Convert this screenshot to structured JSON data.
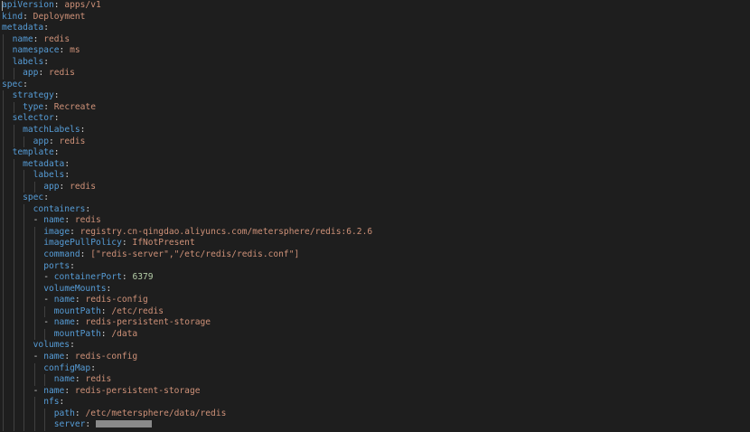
{
  "colors": {
    "background": "#1e1e1e",
    "key": "#569cd6",
    "string": "#ce9178",
    "number": "#b5cea8",
    "punctuation": "#d4d4d4",
    "indent_guide": "#404040"
  },
  "lines": [
    {
      "indent": 0,
      "dash": false,
      "key": "apiVersion",
      "value": "apps/v1",
      "vtype": "str"
    },
    {
      "indent": 0,
      "dash": false,
      "key": "kind",
      "value": "Deployment",
      "vtype": "str"
    },
    {
      "indent": 0,
      "dash": false,
      "key": "metadata",
      "value": "",
      "vtype": "none"
    },
    {
      "indent": 1,
      "dash": false,
      "key": "name",
      "value": "redis",
      "vtype": "str"
    },
    {
      "indent": 1,
      "dash": false,
      "key": "namespace",
      "value": "ms",
      "vtype": "str"
    },
    {
      "indent": 1,
      "dash": false,
      "key": "labels",
      "value": "",
      "vtype": "none"
    },
    {
      "indent": 2,
      "dash": false,
      "key": "app",
      "value": "redis",
      "vtype": "str"
    },
    {
      "indent": 0,
      "dash": false,
      "key": "spec",
      "value": "",
      "vtype": "none"
    },
    {
      "indent": 1,
      "dash": false,
      "key": "strategy",
      "value": "",
      "vtype": "none"
    },
    {
      "indent": 2,
      "dash": false,
      "key": "type",
      "value": "Recreate",
      "vtype": "str"
    },
    {
      "indent": 1,
      "dash": false,
      "key": "selector",
      "value": "",
      "vtype": "none"
    },
    {
      "indent": 2,
      "dash": false,
      "key": "matchLabels",
      "value": "",
      "vtype": "none"
    },
    {
      "indent": 3,
      "dash": false,
      "key": "app",
      "value": "redis",
      "vtype": "str"
    },
    {
      "indent": 1,
      "dash": false,
      "key": "template",
      "value": "",
      "vtype": "none"
    },
    {
      "indent": 2,
      "dash": false,
      "key": "metadata",
      "value": "",
      "vtype": "none"
    },
    {
      "indent": 3,
      "dash": false,
      "key": "labels",
      "value": "",
      "vtype": "none"
    },
    {
      "indent": 4,
      "dash": false,
      "key": "app",
      "value": "redis",
      "vtype": "str"
    },
    {
      "indent": 2,
      "dash": false,
      "key": "spec",
      "value": "",
      "vtype": "none"
    },
    {
      "indent": 3,
      "dash": false,
      "key": "containers",
      "value": "",
      "vtype": "none"
    },
    {
      "indent": 3,
      "dash": true,
      "key": "name",
      "value": "redis",
      "vtype": "str"
    },
    {
      "indent": 4,
      "dash": false,
      "key": "image",
      "value": "registry.cn-qingdao.aliyuncs.com/metersphere/redis:6.2.6",
      "vtype": "str"
    },
    {
      "indent": 4,
      "dash": false,
      "key": "imagePullPolicy",
      "value": "IfNotPresent",
      "vtype": "str"
    },
    {
      "indent": 4,
      "dash": false,
      "key": "command",
      "value": "[\"redis-server\",\"/etc/redis/redis.conf\"]",
      "vtype": "str"
    },
    {
      "indent": 4,
      "dash": false,
      "key": "ports",
      "value": "",
      "vtype": "none"
    },
    {
      "indent": 4,
      "dash": true,
      "key": "containerPort",
      "value": "6379",
      "vtype": "num"
    },
    {
      "indent": 4,
      "dash": false,
      "key": "volumeMounts",
      "value": "",
      "vtype": "none"
    },
    {
      "indent": 4,
      "dash": true,
      "key": "name",
      "value": "redis-config",
      "vtype": "str"
    },
    {
      "indent": 5,
      "dash": false,
      "key": "mountPath",
      "value": "/etc/redis",
      "vtype": "str"
    },
    {
      "indent": 4,
      "dash": true,
      "key": "name",
      "value": "redis-persistent-storage",
      "vtype": "str"
    },
    {
      "indent": 5,
      "dash": false,
      "key": "mountPath",
      "value": "/data",
      "vtype": "str"
    },
    {
      "indent": 3,
      "dash": false,
      "key": "volumes",
      "value": "",
      "vtype": "none"
    },
    {
      "indent": 3,
      "dash": true,
      "key": "name",
      "value": "redis-config",
      "vtype": "str"
    },
    {
      "indent": 4,
      "dash": false,
      "key": "configMap",
      "value": "",
      "vtype": "none"
    },
    {
      "indent": 5,
      "dash": false,
      "key": "name",
      "value": "redis",
      "vtype": "str"
    },
    {
      "indent": 3,
      "dash": true,
      "key": "name",
      "value": "redis-persistent-storage",
      "vtype": "str"
    },
    {
      "indent": 4,
      "dash": false,
      "key": "nfs",
      "value": "",
      "vtype": "none"
    },
    {
      "indent": 5,
      "dash": false,
      "key": "path",
      "value": "/etc/metersphere/data/redis",
      "vtype": "str"
    },
    {
      "indent": 5,
      "dash": false,
      "key": "server",
      "value": "",
      "vtype": "redacted"
    }
  ]
}
